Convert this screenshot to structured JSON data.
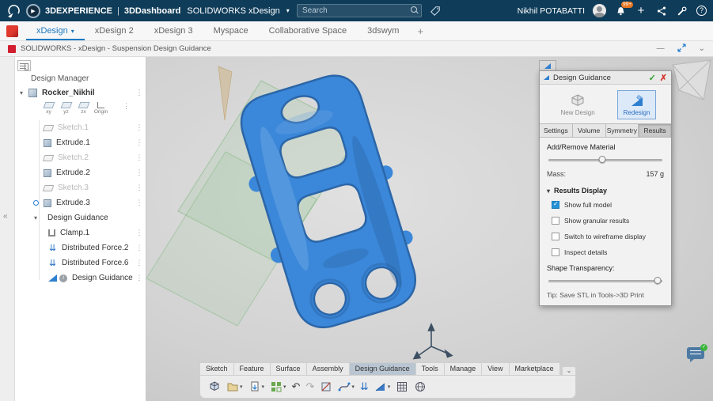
{
  "topbar": {
    "brand": "3DEXPERIENCE",
    "separator": "|",
    "app": "3DDashboard",
    "suite": "SOLIDWORKS xDesign",
    "search_placeholder": "Search",
    "user_name": "Nikhil POTABATTI",
    "notification_badge": "99+"
  },
  "nav_tabs": {
    "items": [
      {
        "label": "xDesign"
      },
      {
        "label": "xDesign 2"
      },
      {
        "label": "xDesign 3"
      },
      {
        "label": "Myspace"
      },
      {
        "label": "Collaborative Space"
      },
      {
        "label": "3dswym"
      }
    ],
    "add_label": "+"
  },
  "window": {
    "title": "SOLIDWORKS - xDesign - Suspension Design Guidance"
  },
  "design_manager": {
    "title": "Design Manager",
    "root_label": "Rocker_Nikhil",
    "planes": [
      {
        "label": "xy"
      },
      {
        "label": "yz"
      },
      {
        "label": "zx"
      },
      {
        "label": "Origin"
      }
    ],
    "items": [
      {
        "label": "Sketch.1"
      },
      {
        "label": "Extrude.1"
      },
      {
        "label": "Sketch.2"
      },
      {
        "label": "Extrude.2"
      },
      {
        "label": "Sketch.3"
      },
      {
        "label": "Extrude.3"
      },
      {
        "label": "Design Guidance"
      },
      {
        "label": "Clamp.1"
      },
      {
        "label": "Distributed Force.2"
      },
      {
        "label": "Distributed Force.6"
      },
      {
        "label": "Design Guidance ..."
      }
    ]
  },
  "guidance_panel": {
    "title": "Design Guidance",
    "modes": [
      {
        "label": "New Design",
        "selected": false
      },
      {
        "label": "Redesign",
        "selected": true
      }
    ],
    "tabs": [
      {
        "label": "Settings"
      },
      {
        "label": "Volume"
      },
      {
        "label": "Symmetry"
      },
      {
        "label": "Results"
      }
    ],
    "active_tab": "Results",
    "material_label": "Add/Remove Material",
    "material_slider_percent": 47,
    "mass_label": "Mass:",
    "mass_value": "157 g",
    "results_section_label": "Results Display",
    "checkboxes": [
      {
        "label": "Show full model",
        "checked": true
      },
      {
        "label": "Show granular results",
        "checked": false
      },
      {
        "label": "Switch to wireframe display",
        "checked": false
      },
      {
        "label": "Inspect details",
        "checked": false
      }
    ],
    "transparency_label": "Shape Transparency:",
    "transparency_slider_percent": 96,
    "tip": "Tip: Save STL in Tools->3D Print"
  },
  "ribbon": {
    "tabs": [
      {
        "label": "Sketch"
      },
      {
        "label": "Feature"
      },
      {
        "label": "Surface"
      },
      {
        "label": "Assembly"
      },
      {
        "label": "Design Guidance"
      },
      {
        "label": "Tools"
      },
      {
        "label": "Manage"
      },
      {
        "label": "View"
      },
      {
        "label": "Marketplace"
      }
    ],
    "active_tab": "Design Guidance",
    "tool_icons": [
      "part-import-icon",
      "open-icon",
      "export-icon",
      "apps-icon",
      "undo-icon",
      "redo-icon",
      "section-icon",
      "spline-icon",
      "distributed-load-icon",
      "design-guidance-icon",
      "pattern-grid-icon",
      "evaluate-globe-icon"
    ]
  },
  "icons": {
    "caret_down": "▾",
    "menu_dots": "⋮",
    "check": "✓",
    "close": "✗",
    "plus": "+",
    "help": "?",
    "undo": "↶",
    "redo": "↷",
    "loads": "⇊",
    "collapse_left": "«",
    "minimize": "—",
    "panel_collapse": "⌄",
    "expand_section": "▾",
    "info": "i"
  }
}
